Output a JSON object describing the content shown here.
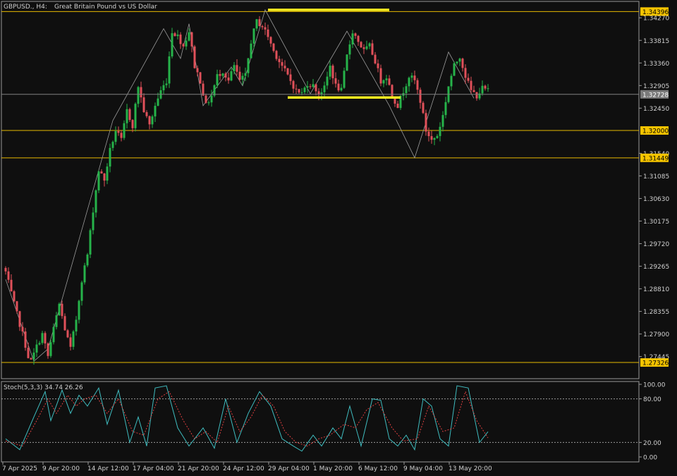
{
  "header": {
    "symbol_label": "GBPUSD., H4:",
    "description": "Great Britain Pound vs US Dollar"
  },
  "colors": {
    "background": "#0f0f0f",
    "grid_border": "#9a9a9a",
    "bull_candle": "#26b34a",
    "bear_candle": "#e0505a",
    "level_line": "#e6b800",
    "level_label_bg": "#f5c400",
    "drawn_line": "#f8ee20",
    "current_price_line": "#808080",
    "current_price_label_bg": "#7a7a7a",
    "zigzag": "#9a9a9a",
    "stoch_main": "#3fbcbf",
    "stoch_signal": "#e04040"
  },
  "price_axis": {
    "tick_labels": [
      "1.34270",
      "1.33815",
      "1.33360",
      "1.32905",
      "1.32450",
      "1.31540",
      "1.31085",
      "1.30630",
      "1.30175",
      "1.29720",
      "1.29265",
      "1.28810",
      "1.28355",
      "1.27900",
      "1.27445"
    ]
  },
  "level_labels": [
    "1.34396",
    "1.32000",
    "1.31449",
    "1.27326"
  ],
  "current_price_label": "1.32728",
  "time_axis": {
    "labels": [
      "7 Apr 2025",
      "9 Apr 20:00",
      "14 Apr 12:00",
      "17 Apr 04:00",
      "21 Apr 20:00",
      "24 Apr 12:00",
      "29 Apr 04:00",
      "1 May 20:00",
      "6 May 12:00",
      "9 May 04:00",
      "13 May 20:00"
    ]
  },
  "indicator": {
    "label": "Stoch(5,3,3) 34.74 26.26",
    "scale_labels": [
      "100.00",
      "80.00",
      "20.00",
      "0.00"
    ]
  },
  "chart_data": {
    "type": "candlestick",
    "title": "GBPUSD., H4:  Great Britain Pound vs US Dollar",
    "x_range": [
      "7 Apr 2025",
      "14 May 2025"
    ],
    "y_range": [
      1.27,
      1.346
    ],
    "y_ticks": [
      1.3427,
      1.33815,
      1.3336,
      1.32905,
      1.3245,
      1.3154,
      1.31085,
      1.3063,
      1.30175,
      1.2972,
      1.29265,
      1.2881,
      1.28355,
      1.279,
      1.27445
    ],
    "x_tick_labels": [
      "7 Apr 2025",
      "9 Apr 20:00",
      "14 Apr 12:00",
      "17 Apr 04:00",
      "21 Apr 20:00",
      "24 Apr 12:00",
      "29 Apr 04:00",
      "1 May 20:00",
      "6 May 12:00",
      "9 May 04:00",
      "13 May 20:00"
    ],
    "close_path": [
      [
        0,
        1.2915
      ],
      [
        3,
        1.285
      ],
      [
        6,
        1.279
      ],
      [
        8,
        1.2745
      ],
      [
        9,
        1.2735
      ],
      [
        11,
        1.2765
      ],
      [
        13,
        1.279
      ],
      [
        15,
        1.2745
      ],
      [
        17,
        1.28
      ],
      [
        19,
        1.285
      ],
      [
        21,
        1.28
      ],
      [
        23,
        1.276
      ],
      [
        25,
        1.282
      ],
      [
        27,
        1.29
      ],
      [
        29,
        1.295
      ],
      [
        31,
        1.304
      ],
      [
        33,
        1.312
      ],
      [
        35,
        1.31
      ],
      [
        37,
        1.316
      ],
      [
        39,
        1.32
      ],
      [
        41,
        1.318
      ],
      [
        43,
        1.324
      ],
      [
        45,
        1.321
      ],
      [
        47,
        1.329
      ],
      [
        49,
        1.324
      ],
      [
        51,
        1.321
      ],
      [
        53,
        1.325
      ],
      [
        55,
        1.328
      ],
      [
        57,
        1.33
      ],
      [
        59,
        1.34
      ],
      [
        61,
        1.339
      ],
      [
        63,
        1.337
      ],
      [
        65,
        1.34
      ],
      [
        67,
        1.333
      ],
      [
        69,
        1.33
      ],
      [
        71,
        1.325
      ],
      [
        73,
        1.327
      ],
      [
        75,
        1.331
      ],
      [
        77,
        1.332
      ],
      [
        79,
        1.33
      ],
      [
        81,
        1.333
      ],
      [
        83,
        1.33
      ],
      [
        85,
        1.331
      ],
      [
        87,
        1.338
      ],
      [
        89,
        1.342
      ],
      [
        91,
        1.341
      ],
      [
        93,
        1.339
      ],
      [
        95,
        1.336
      ],
      [
        97,
        1.334
      ],
      [
        99,
        1.332
      ],
      [
        101,
        1.33
      ],
      [
        103,
        1.328
      ],
      [
        105,
        1.3275
      ],
      [
        107,
        1.3295
      ],
      [
        109,
        1.329
      ],
      [
        111,
        1.3275
      ],
      [
        113,
        1.3285
      ],
      [
        115,
        1.333
      ],
      [
        117,
        1.329
      ],
      [
        119,
        1.328
      ],
      [
        121,
        1.335
      ],
      [
        123,
        1.34
      ],
      [
        125,
        1.338
      ],
      [
        127,
        1.336
      ],
      [
        129,
        1.337
      ],
      [
        131,
        1.334
      ],
      [
        133,
        1.33
      ],
      [
        135,
        1.331
      ],
      [
        137,
        1.327
      ],
      [
        139,
        1.325
      ],
      [
        141,
        1.328
      ],
      [
        143,
        1.331
      ],
      [
        145,
        1.33
      ],
      [
        147,
        1.326
      ],
      [
        149,
        1.32
      ],
      [
        151,
        1.318
      ],
      [
        153,
        1.319
      ],
      [
        155,
        1.323
      ],
      [
        157,
        1.329
      ],
      [
        159,
        1.333
      ],
      [
        161,
        1.335
      ],
      [
        163,
        1.331
      ],
      [
        165,
        1.328
      ],
      [
        167,
        1.327
      ],
      [
        169,
        1.3285
      ],
      [
        171,
        1.328
      ]
    ],
    "levels": [
      1.34396,
      1.32,
      1.31449,
      1.27326
    ],
    "current_price": 1.32728,
    "drawn_lines": [
      {
        "x": [
          93,
          136
        ],
        "y": [
          1.3443,
          1.3443
        ]
      },
      {
        "x": [
          100,
          140
        ],
        "y": [
          1.32664,
          1.32664
        ]
      }
    ],
    "zigzag": [
      [
        0,
        1.29
      ],
      [
        10,
        1.2735
      ],
      [
        15,
        1.276
      ],
      [
        38,
        1.322
      ],
      [
        56,
        1.3405
      ],
      [
        62,
        1.3345
      ],
      [
        65,
        1.3415
      ],
      [
        70,
        1.325
      ],
      [
        80,
        1.3328
      ],
      [
        84,
        1.329
      ],
      [
        92,
        1.3443
      ],
      [
        108,
        1.3274
      ],
      [
        121,
        1.34
      ],
      [
        136,
        1.325
      ],
      [
        145,
        1.3145
      ],
      [
        157,
        1.3358
      ],
      [
        166,
        1.3265
      ]
    ],
    "stochastic": {
      "name": "Stoch(5,3,3)",
      "main_value": 34.74,
      "signal_value": 26.26,
      "y_range": [
        0,
        100
      ],
      "levels": [
        80,
        20
      ],
      "main": [
        [
          0,
          25
        ],
        [
          5,
          10
        ],
        [
          10,
          55
        ],
        [
          14,
          90
        ],
        [
          16,
          50
        ],
        [
          20,
          92
        ],
        [
          23,
          60
        ],
        [
          26,
          85
        ],
        [
          29,
          70
        ],
        [
          33,
          95
        ],
        [
          36,
          45
        ],
        [
          40,
          92
        ],
        [
          44,
          20
        ],
        [
          47,
          55
        ],
        [
          50,
          15
        ],
        [
          53,
          95
        ],
        [
          57,
          98
        ],
        [
          61,
          40
        ],
        [
          65,
          15
        ],
        [
          70,
          40
        ],
        [
          74,
          12
        ],
        [
          78,
          80
        ],
        [
          82,
          20
        ],
        [
          86,
          60
        ],
        [
          90,
          90
        ],
        [
          94,
          70
        ],
        [
          98,
          25
        ],
        [
          102,
          15
        ],
        [
          105,
          8
        ],
        [
          109,
          30
        ],
        [
          112,
          15
        ],
        [
          116,
          40
        ],
        [
          119,
          25
        ],
        [
          122,
          70
        ],
        [
          126,
          15
        ],
        [
          130,
          80
        ],
        [
          133,
          78
        ],
        [
          136,
          25
        ],
        [
          139,
          15
        ],
        [
          142,
          30
        ],
        [
          145,
          10
        ],
        [
          148,
          80
        ],
        [
          151,
          70
        ],
        [
          154,
          25
        ],
        [
          157,
          15
        ],
        [
          160,
          98
        ],
        [
          164,
          95
        ],
        [
          168,
          20
        ],
        [
          171,
          34.74
        ]
      ],
      "signal": [
        [
          0,
          22
        ],
        [
          6,
          15
        ],
        [
          11,
          50
        ],
        [
          15,
          80
        ],
        [
          18,
          60
        ],
        [
          22,
          85
        ],
        [
          25,
          70
        ],
        [
          28,
          80
        ],
        [
          32,
          85
        ],
        [
          36,
          60
        ],
        [
          40,
          80
        ],
        [
          45,
          35
        ],
        [
          49,
          30
        ],
        [
          54,
          80
        ],
        [
          58,
          90
        ],
        [
          63,
          50
        ],
        [
          67,
          25
        ],
        [
          71,
          35
        ],
        [
          75,
          20
        ],
        [
          79,
          70
        ],
        [
          83,
          35
        ],
        [
          87,
          55
        ],
        [
          91,
          85
        ],
        [
          95,
          70
        ],
        [
          99,
          35
        ],
        [
          103,
          20
        ],
        [
          107,
          15
        ],
        [
          111,
          25
        ],
        [
          115,
          30
        ],
        [
          120,
          45
        ],
        [
          124,
          40
        ],
        [
          128,
          65
        ],
        [
          132,
          75
        ],
        [
          137,
          40
        ],
        [
          141,
          22
        ],
        [
          146,
          25
        ],
        [
          150,
          70
        ],
        [
          155,
          35
        ],
        [
          159,
          40
        ],
        [
          163,
          90
        ],
        [
          167,
          50
        ],
        [
          171,
          26.26
        ]
      ]
    }
  }
}
